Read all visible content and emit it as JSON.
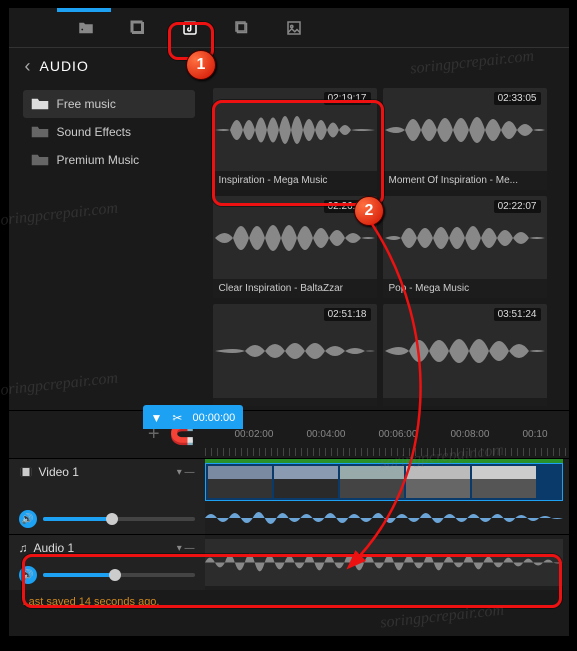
{
  "panel": {
    "title": "AUDIO"
  },
  "sidebar": {
    "items": [
      {
        "label": "Free music",
        "selected": true
      },
      {
        "label": "Sound Effects",
        "selected": false
      },
      {
        "label": "Premium Music",
        "selected": false
      }
    ]
  },
  "clips": [
    {
      "title": "Inspiration - Mega Music",
      "duration": "02:19:17"
    },
    {
      "title": "Moment Of Inspiration - Me...",
      "duration": "02:33:05"
    },
    {
      "title": "Clear Inspiration - BaltaZzar",
      "duration": "02:26:21"
    },
    {
      "title": "Pop - Mega Music",
      "duration": "02:22:07"
    },
    {
      "title": "",
      "duration": "02:51:18"
    },
    {
      "title": "",
      "duration": "03:51:24"
    }
  ],
  "timeline": {
    "playhead": "00:00:00",
    "ticks": [
      "00:02:00",
      "00:04:00",
      "00:06:00",
      "00:08:00",
      "00:10"
    ]
  },
  "tracks": {
    "video": {
      "label": "Video 1"
    },
    "audio": {
      "label": "Audio 1"
    }
  },
  "status": {
    "text": "Last saved 14 seconds ago."
  },
  "icons": {
    "tabs": [
      "folder-star-icon",
      "templates-icon",
      "music-icon",
      "layers-icon",
      "image-icon"
    ]
  },
  "watermark": "soringpcrepair.com"
}
